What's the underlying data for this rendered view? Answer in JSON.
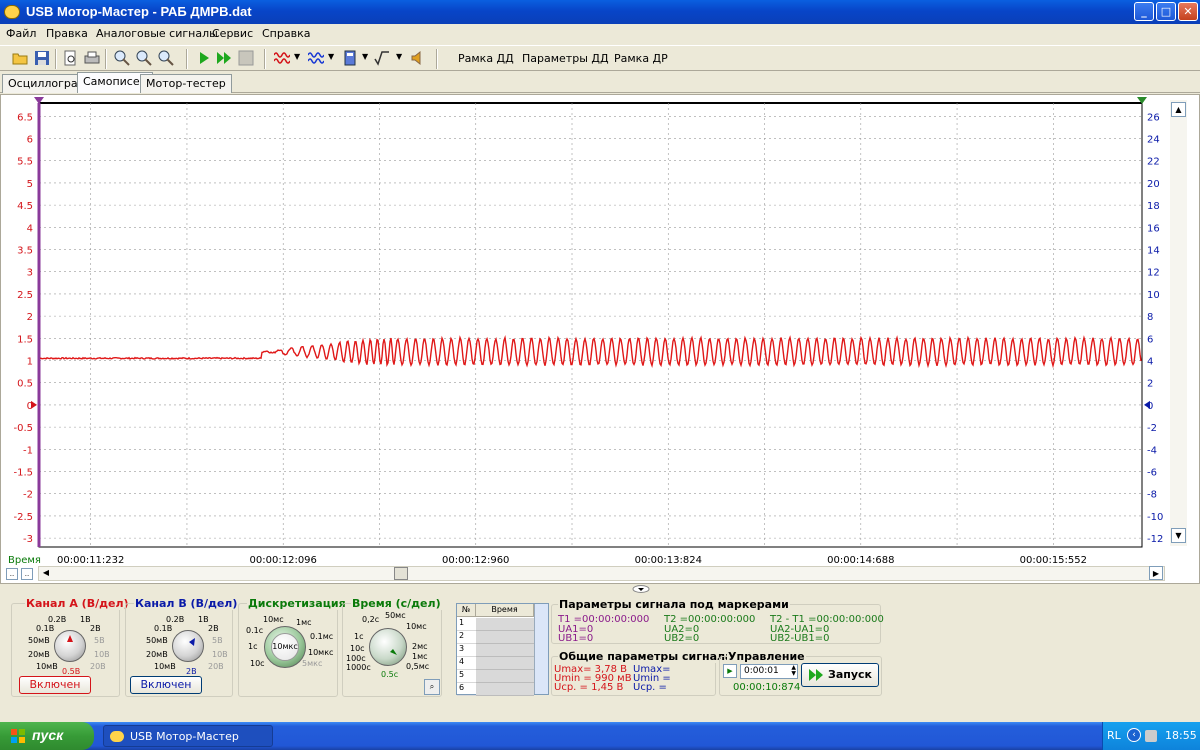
{
  "window": {
    "title": "USB Мотор-Мастер - РАБ ДМРВ.dat",
    "buttons": {
      "minimize": "_",
      "maximize": "□",
      "close": "✕"
    }
  },
  "menu": [
    "Файл",
    "Правка",
    "Аналоговые сигналы",
    "Сервис",
    "Справка"
  ],
  "toolbar": {
    "icons": [
      "open-folder-icon",
      "save-icon",
      "print-preview-icon",
      "print-icon",
      "zoom-in-icon",
      "zoom-out-icon",
      "zoom-fit-icon",
      "play-icon",
      "fast-play-icon",
      "stop-icon",
      "signal-a-icon",
      "signal-b-icon",
      "calculator-icon",
      "sqrt-icon",
      "sound-icon"
    ],
    "text_buttons": [
      "Рамка ДД",
      "Параметры ДД",
      "Рамка ДР"
    ]
  },
  "tabs": [
    {
      "label": "Осциллограф",
      "active": false
    },
    {
      "label": "Самописец",
      "active": true
    },
    {
      "label": "Мотор-тестер",
      "active": false
    }
  ],
  "plot": {
    "colors": {
      "left_axis": "#d4141a",
      "right_axis": "#0a1aa8",
      "trace": "#e01818",
      "grid": "#9a9a9a",
      "marker_left": "#8a3a9a",
      "marker_right": "#2a8a2a"
    },
    "time_axis_label": "Время"
  },
  "chart_data": {
    "type": "line",
    "left_yticks": [
      "6.5",
      "6",
      "5.5",
      "5",
      "4.5",
      "4",
      "3.5",
      "3",
      "2.5",
      "2",
      "1.5",
      "1",
      "0.5",
      "0",
      "-0.5",
      "-1",
      "-1.5",
      "-2",
      "-2.5",
      "-3"
    ],
    "right_yticks": [
      "26",
      "24",
      "22",
      "20",
      "18",
      "16",
      "14",
      "12",
      "10",
      "8",
      "6",
      "4",
      "2",
      "0",
      "-2",
      "-4",
      "-6",
      "-8",
      "-10",
      "-12"
    ],
    "left_ylim": [
      -3.2,
      6.8
    ],
    "right_ylim": [
      -12.8,
      27.2
    ],
    "x_ticks": [
      "00:00:11:232",
      "00:00:12:096",
      "00:00:12:960",
      "00:00:13:824",
      "00:00:14:688",
      "00:00:15:552"
    ],
    "x_range_s": [
      11.0,
      15.95
    ],
    "series": [
      {
        "baseline_v": 1.05,
        "baseline_until_s": 12.0,
        "oscillation_mean_v": 1.2,
        "oscillation_amplitude_v": 0.3,
        "oscillation_start_s": 12.0
      }
    ]
  },
  "lower": {
    "channel_a": {
      "title": "Канал А (В/дел)",
      "labels": [
        "0.2В",
        "1В",
        "0.1В",
        "2В",
        "50мВ",
        "5В",
        "20мВ",
        "10В",
        "10мВ",
        "0.5В",
        "20В"
      ],
      "button": "Включен",
      "color": "#d4141a"
    },
    "channel_b": {
      "title": "Канал В (В/дел)",
      "labels": [
        "0.2В",
        "1В",
        "0.1В",
        "2В",
        "50мВ",
        "5В",
        "20мВ",
        "10В",
        "10мВ",
        "2В",
        "20В"
      ],
      "button": "Включен",
      "color": "#0a1aa8"
    },
    "discretization": {
      "title": "Дискретизация",
      "labels": [
        "10мс",
        "1мс",
        "0.1с",
        "0.1мс",
        "1с",
        "10мкс",
        "10мкс",
        "10с",
        "5мкс"
      ],
      "color": "#0a7a0a"
    },
    "time": {
      "title": "Время (с/дел)",
      "labels": [
        "50мс",
        "0,2с",
        "10мс",
        "1с",
        "2мс",
        "10с",
        "100с",
        "1мс",
        "1000с",
        "0,5мс",
        "0.5с"
      ],
      "color": "#0a7a0a"
    },
    "marker_table": {
      "headers": [
        "№",
        "Время"
      ],
      "rows": [
        "1",
        "2",
        "3",
        "4",
        "5",
        "6"
      ]
    },
    "marker_params": {
      "title": "Параметры сигнала под маркерами",
      "t1": "T1 =00:00:00:000",
      "ua1": "UA1=0",
      "ub1": "UB1=0",
      "t2": "T2 =00:00:00:000",
      "ua2": "UA2=0",
      "ub2": "UB2=0",
      "dt": "T2 - T1 =00:00:00:000",
      "dua": "UA2-UA1=0",
      "dub": "UB2-UB1=0"
    },
    "general_params": {
      "title": "Общие параметры сигнала",
      "umax_a": "Umax= 3,78 В",
      "umin_a": "Umin = 990 мВ",
      "ucp_a": "Uср. = 1,45 В",
      "umax_b": "Umax=",
      "umin_b": "Umin =",
      "ucp_b": "Uср. ="
    },
    "control": {
      "title": "Управление",
      "time_value": "0:00:01",
      "elapsed": "00:00:10:874",
      "start_button": "Запуск"
    }
  },
  "taskbar": {
    "start_label": "пуск",
    "task_label": "USB Мотор-Мастер",
    "tray_lang": "RL",
    "clock": "18:55"
  }
}
